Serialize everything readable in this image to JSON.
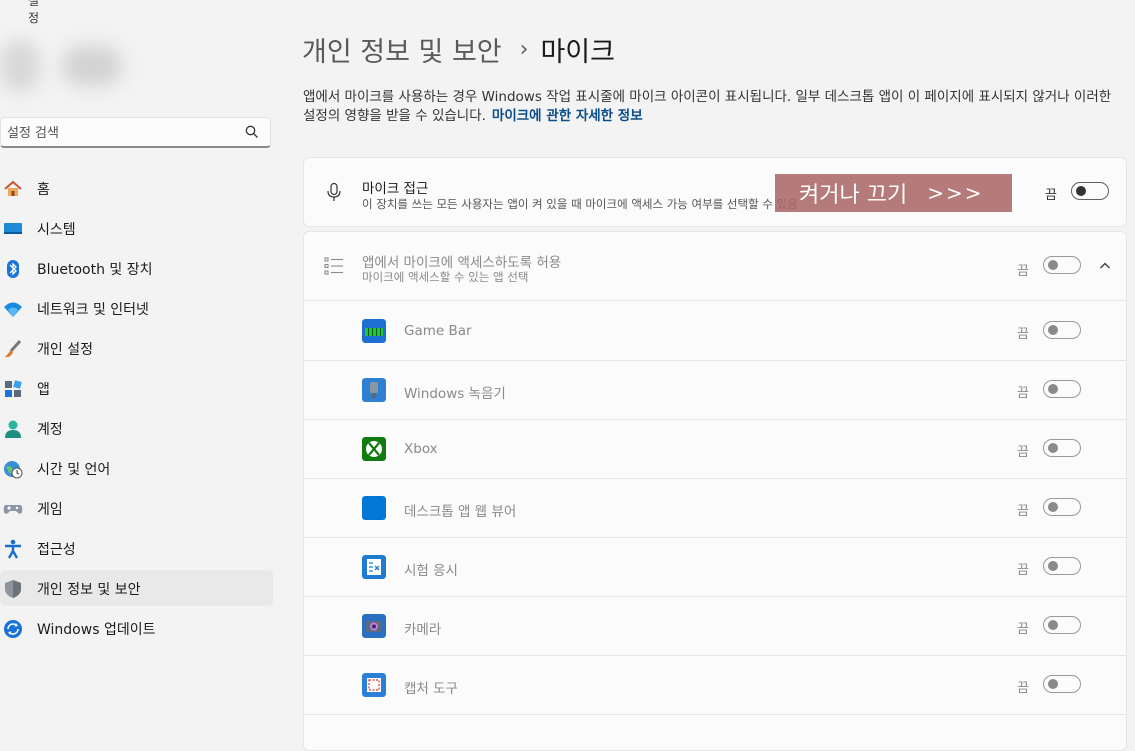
{
  "window": {
    "title": "설정"
  },
  "search": {
    "placeholder": "설정 검색"
  },
  "nav": {
    "items": [
      {
        "label": "홈",
        "icon": "home-icon"
      },
      {
        "label": "시스템",
        "icon": "monitor-icon"
      },
      {
        "label": "Bluetooth 및 장치",
        "icon": "bluetooth-icon"
      },
      {
        "label": "네트워크 및 인터넷",
        "icon": "wifi-icon"
      },
      {
        "label": "개인 설정",
        "icon": "brush-icon"
      },
      {
        "label": "앱",
        "icon": "apps-icon"
      },
      {
        "label": "계정",
        "icon": "account-icon"
      },
      {
        "label": "시간 및 언어",
        "icon": "globe-clock-icon"
      },
      {
        "label": "게임",
        "icon": "gamepad-icon"
      },
      {
        "label": "접근성",
        "icon": "accessibility-icon"
      },
      {
        "label": "개인 정보 및 보안",
        "icon": "shield-icon",
        "active": true
      },
      {
        "label": "Windows 업데이트",
        "icon": "update-icon"
      }
    ]
  },
  "header": {
    "parent": "개인 정보 및 보안",
    "separator": "›",
    "current": "마이크"
  },
  "description": {
    "text": "앱에서 마이크를 사용하는 경우 Windows 작업 표시줄에 마이크 아이콘이 표시됩니다. 일부 데스크톱 앱이 이 페이지에 표시되지 않거나 이러한 설정의 영향을 받을 수 있습니다.",
    "link": "마이크에 관한 자세한 정보"
  },
  "mic_access": {
    "title": "마이크 접근",
    "subtitle": "이 장치를 쓰는 모든 사용자는 앱이 켜 있을 때 마이크에 액세스 가능 여부를 선택할 수 있음",
    "state": "끔",
    "on": false
  },
  "overlay": {
    "text": "켜거나 끄기",
    "arrows": ">>>"
  },
  "app_access": {
    "title": "앱에서 마이크에 액세스하도록 허용",
    "subtitle": "마이크에 액세스할 수 있는 앱 선택",
    "state": "끔",
    "on": false
  },
  "apps": [
    {
      "name": "Game Bar",
      "state": "끔",
      "color": "#0a8f3c"
    },
    {
      "name": "Windows 녹음기",
      "state": "끔",
      "color": "#2f80d1"
    },
    {
      "name": "Xbox",
      "state": "끔",
      "color": "#107c10"
    },
    {
      "name": "데스크톱 앱 웹 뷰어",
      "state": "끔",
      "color": "#0078d4"
    },
    {
      "name": "시험 응시",
      "state": "끔",
      "color": "#1f7bd1"
    },
    {
      "name": "카메라",
      "state": "끔",
      "color": "#2a6fc2"
    },
    {
      "name": "캡처 도구",
      "state": "끔",
      "color": "#2b7fd6"
    }
  ],
  "colors": {
    "accent": "#0a4d8c",
    "overlay": "#ab6868"
  }
}
